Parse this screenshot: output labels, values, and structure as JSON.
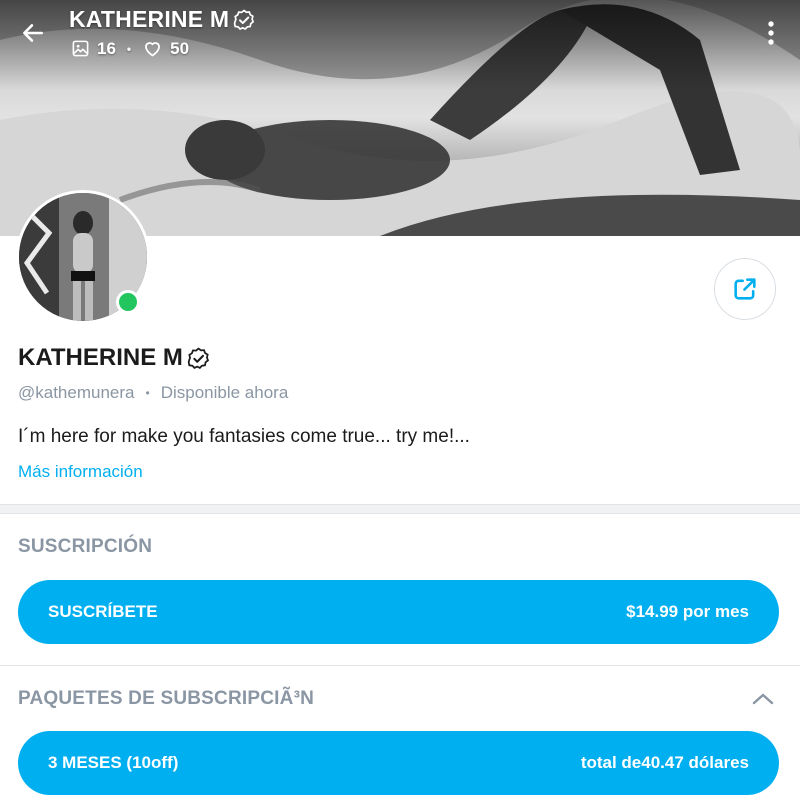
{
  "header": {
    "title": "KATHERINE M",
    "photos_count": "16",
    "likes_count": "50",
    "separator": "•"
  },
  "profile": {
    "name": "KATHERINE M",
    "handle": "@kathemunera",
    "separator": "•",
    "status": "Disponible ahora",
    "bio": "I´m here for make you fantasies come true... try me!...",
    "more_info_label": "Más información"
  },
  "subscription": {
    "section_title": "SUSCRIPCIÓN",
    "button_label": "SUSCRÍBETE",
    "price": "$14.99 por mes"
  },
  "bundles": {
    "section_title": "PAQUETES DE SUBSCRIPCIÃ³N",
    "items": [
      {
        "label": "3 MESES (10off)",
        "price": "total de40.47 dólares"
      }
    ]
  },
  "icons": {
    "back": "arrow-left-icon",
    "verified": "verified-badge-icon",
    "photos": "image-icon",
    "likes": "heart-icon",
    "more": "more-vertical-icon",
    "share": "share-icon",
    "collapse": "chevron-up-icon"
  },
  "colors": {
    "accent": "#00aff0",
    "muted": "#8a96a3",
    "online": "#22c55e",
    "text": "#1b1b1b"
  }
}
